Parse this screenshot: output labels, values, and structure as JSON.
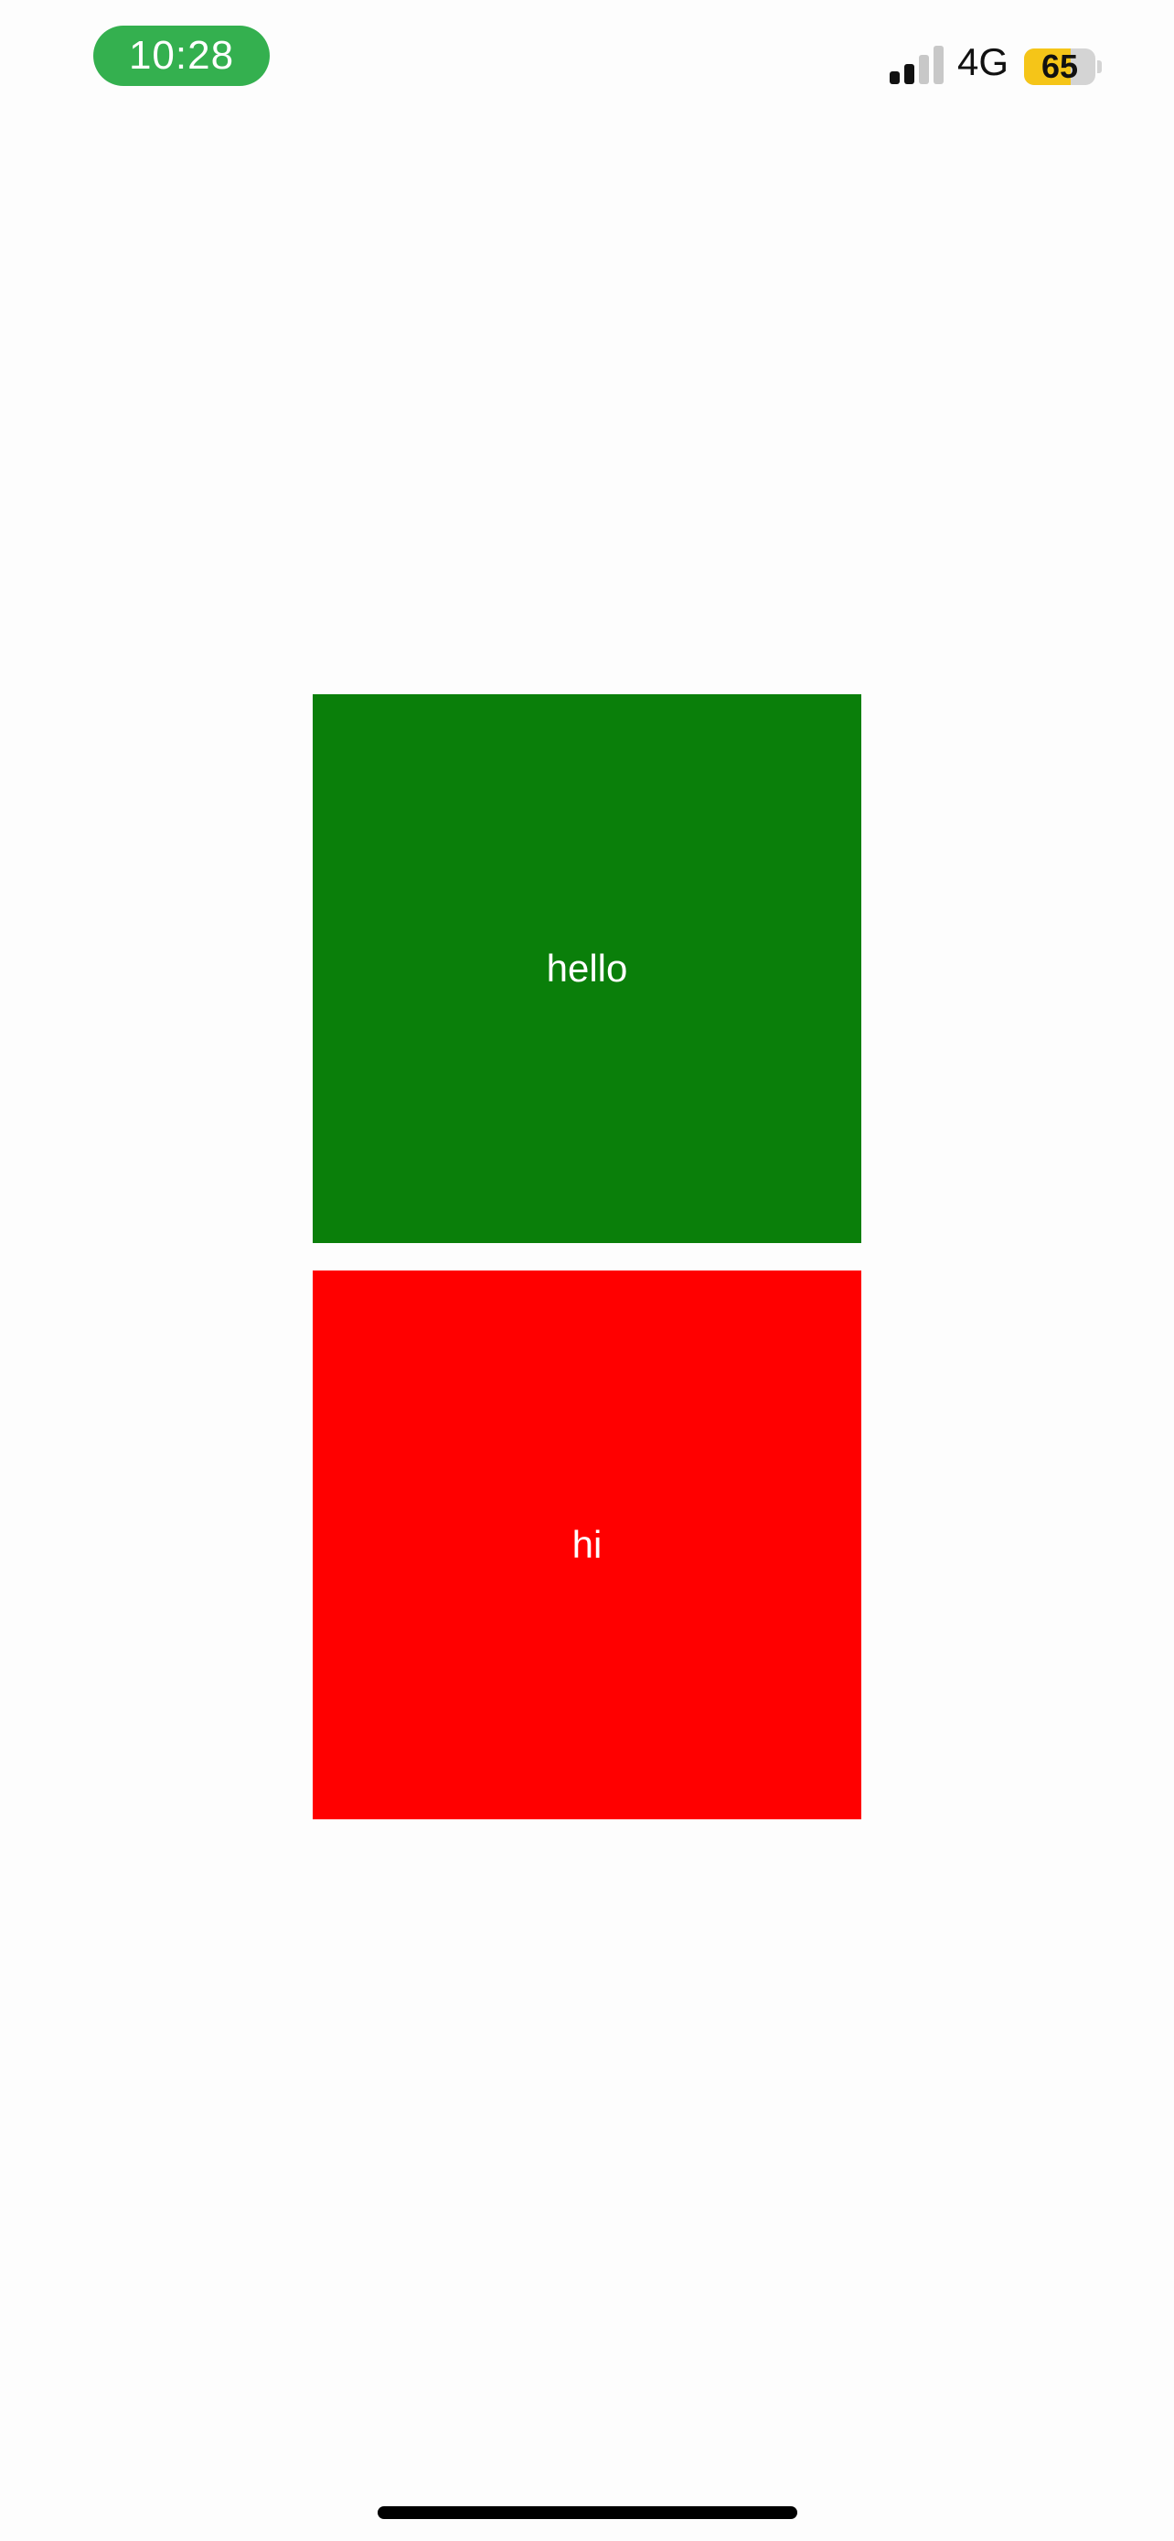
{
  "status_bar": {
    "time": "10:28",
    "time_pill_color": "#34b04f",
    "network": "4G",
    "battery_level": "65",
    "battery_fill_color": "#f5c518",
    "battery_empty_color": "#d4d4d4",
    "signal_bars_total": 4,
    "signal_bars_active": 2,
    "signal_active_color": "#111111",
    "signal_inactive_color": "#c8c8c8",
    "icons": [
      "signal-icon",
      "battery-icon"
    ]
  },
  "boxes": [
    {
      "label": "hello",
      "color": "#0a7f0a"
    },
    {
      "label": "hi",
      "color": "#ff0000"
    }
  ]
}
